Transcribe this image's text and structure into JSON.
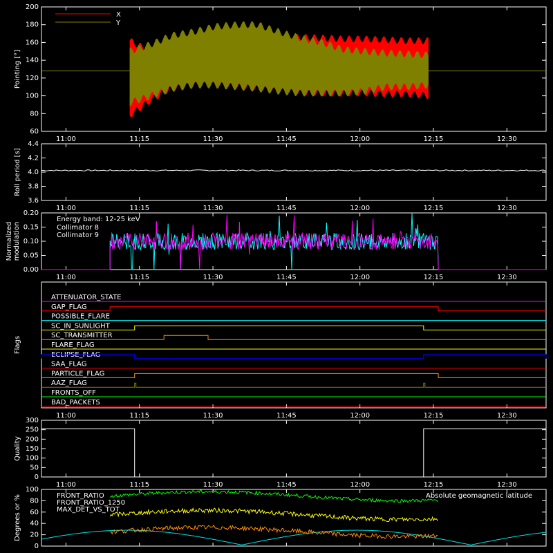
{
  "colors": {
    "axis": "#ffffff",
    "x_pointing": "#ff0000",
    "y_pointing": "#808000",
    "roll": "#ffffff",
    "coll8": "#00ffff",
    "coll9": "#ff00ff",
    "white_band": "#ffffff",
    "front_ratio": "#00ff00",
    "front_ratio_12": "#ffff00",
    "max_det": "#ff8c00",
    "geo_lat": "#00e5e5"
  },
  "time_ticks": [
    "11:00",
    "11:15",
    "11:30",
    "11:45",
    "12:00",
    "12:15",
    "12:30"
  ],
  "chart_data": [
    {
      "id": "pointing",
      "type": "area",
      "ylabel": "Pointing [°]",
      "ylim": [
        60,
        200
      ],
      "yticks": [
        "60",
        "80",
        "100",
        "120",
        "140",
        "160",
        "180",
        "200"
      ],
      "series": [
        {
          "name": "X",
          "color": "#ff0000",
          "x_start": "11:13",
          "x_end": "12:14",
          "upper": [
            162,
            150,
            155,
            158,
            160,
            158,
            162,
            165,
            166,
            165,
            164,
            164,
            163,
            162,
            162
          ],
          "lower": [
            78,
            95,
            110,
            115,
            115,
            112,
            110,
            108,
            105,
            103,
            103,
            103,
            102,
            102,
            100
          ]
        },
        {
          "name": "Y",
          "color": "#808000",
          "x_start": "11:13",
          "x_end": "12:14",
          "upper": [
            150,
            158,
            168,
            172,
            178,
            180,
            180,
            172,
            165,
            160,
            152,
            150,
            148,
            147,
            146
          ],
          "lower": [
            92,
            100,
            108,
            112,
            112,
            110,
            108,
            105,
            103,
            103,
            103,
            105,
            110,
            110,
            112
          ]
        }
      ],
      "reference_line": 128,
      "legend": "top-left"
    },
    {
      "id": "roll",
      "type": "line",
      "ylabel": "Roll period [s]",
      "ylim": [
        3.5,
        4.5
      ],
      "yticks": [
        "3.6",
        "3.8",
        "4.0",
        "4.2",
        "4.4"
      ],
      "series": [
        {
          "x_start": "10:55",
          "x_end": "12:38",
          "value": 4.03
        }
      ]
    },
    {
      "id": "modulation",
      "type": "line",
      "ylabel": "Normalized modulation",
      "ylim": [
        0,
        0.2
      ],
      "yticks": [
        "0.00",
        "0.05",
        "0.10",
        "0.15",
        "0.20"
      ],
      "annotation": "Energy band: 12-25 keV",
      "series": [
        {
          "name": "Collimator 8",
          "color": "#00ffff",
          "x_start": "11:09",
          "x_end": "12:16",
          "baseline": 0.1,
          "noise": 0.03
        },
        {
          "name": "Collimator 9",
          "color": "#ff00ff",
          "x_start": "11:09",
          "x_end": "12:16",
          "baseline": 0.1,
          "noise": 0.03
        }
      ],
      "legend": "top-left"
    },
    {
      "id": "flags",
      "type": "line",
      "ylabel": "Flags",
      "rows": [
        {
          "name": "ATTENUATOR_STATE",
          "color": "#ff00ff",
          "steps": []
        },
        {
          "name": "GAP_FLAG",
          "color": "#ff0000",
          "steps": [
            [
              "11:09",
              "12:16"
            ]
          ]
        },
        {
          "name": "POSSIBLE_FLARE",
          "color": "#00ffff",
          "steps": []
        },
        {
          "name": "SC_IN_SUNLIGHT",
          "color": "#ffff00",
          "steps": [
            [
              "11:14",
              "12:13"
            ]
          ]
        },
        {
          "name": "SC_TRANSMITTER",
          "color": "#ff8c00",
          "steps": [
            [
              "11:20",
              "11:29"
            ]
          ]
        },
        {
          "name": "FLARE_FLAG",
          "color": "#ffff00",
          "steps": []
        },
        {
          "name": "ECLIPSE_FLAG",
          "color": "#0000ff",
          "steps": [
            [
              "10:55",
              "11:14"
            ],
            [
              "12:13",
              "12:38"
            ]
          ]
        },
        {
          "name": "SAA_FLAG",
          "color": "#ff0000",
          "steps": []
        },
        {
          "name": "PARTICLE_FLAG",
          "color": "#ff8c00",
          "steps": [
            [
              "11:14",
              "12:16"
            ]
          ]
        },
        {
          "name": "AAZ_FLAG",
          "color": "#808000",
          "steps": [
            [
              "11:14",
              "11:14"
            ],
            [
              "12:13",
              "12:13"
            ]
          ]
        },
        {
          "name": "FRONTS_OFF",
          "color": "#00ff00",
          "steps": []
        },
        {
          "name": "BAD_PACKETS",
          "color": "#ff0000",
          "steps": []
        }
      ]
    },
    {
      "id": "quality",
      "type": "line",
      "ylabel": "Quality",
      "ylim": [
        0,
        300
      ],
      "yticks": [
        "0",
        "50",
        "100",
        "150",
        "200",
        "250",
        "300"
      ],
      "series": [
        {
          "segments": [
            [
              "10:55",
              "11:14",
              255
            ],
            [
              "11:14",
              "12:13",
              0
            ],
            [
              "12:13",
              "12:38",
              255
            ]
          ]
        }
      ]
    },
    {
      "id": "ratios",
      "type": "line",
      "ylabel": "Degrees or %",
      "ylim": [
        0,
        100
      ],
      "yticks": [
        "0",
        "20",
        "40",
        "60",
        "80",
        "100"
      ],
      "series": [
        {
          "name": "FRONT_RATIO",
          "color": "#00ff00"
        },
        {
          "name": "FRONT_RATIO_1250",
          "color": "#00ff00"
        },
        {
          "name": "MAX_DET_VS_TOT",
          "color": "#ff8c00"
        },
        {
          "name": "Absolute geomagnetic latitude",
          "color": "#00e5e5"
        }
      ],
      "legend": "top-left"
    }
  ]
}
